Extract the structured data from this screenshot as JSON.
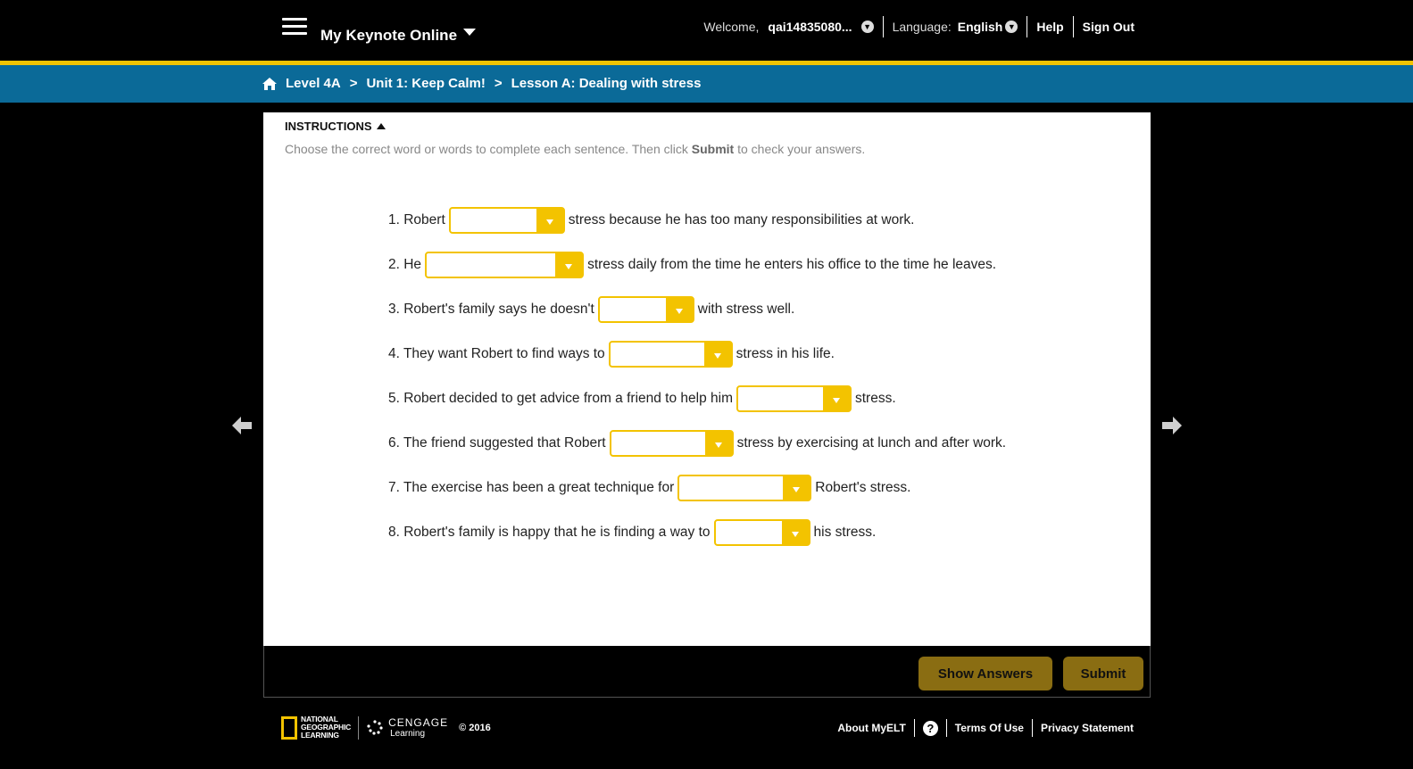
{
  "header": {
    "app_title": "My Keynote Online",
    "welcome_label": "Welcome,",
    "username": "qai14835080...",
    "language_label": "Language:",
    "language_value": "English",
    "help_label": "Help",
    "signout_label": "Sign Out"
  },
  "breadcrumb": {
    "items": [
      "Level 4A",
      "Unit 1: Keep Calm!",
      "Lesson A: Dealing with stress"
    ],
    "separator": ">"
  },
  "instructions": {
    "toggle_label": "INSTRUCTIONS",
    "text_before": "Choose the correct word or words to complete each sentence. Then click ",
    "text_bold": "Submit",
    "text_after": " to check your answers."
  },
  "questions": [
    {
      "before": "1. Robert",
      "after": "stress because he has too many responsibilities at work.",
      "selected": ""
    },
    {
      "before": "2. He",
      "after": "stress daily from the time he enters his office to the time he leaves.",
      "selected": ""
    },
    {
      "before": "3. Robert's family says he doesn't",
      "after": "with stress well.",
      "selected": ""
    },
    {
      "before": "4. They want Robert to find ways to",
      "after": "stress in his life.",
      "selected": ""
    },
    {
      "before": "5. Robert decided to get advice from a friend to help him",
      "after": "stress.",
      "selected": ""
    },
    {
      "before": "6. The friend suggested that Robert",
      "after": "stress by exercising at lunch and after work.",
      "selected": ""
    },
    {
      "before": "7. The exercise has been a great technique for",
      "after": "Robert's stress.",
      "selected": ""
    },
    {
      "before": "8. Robert's family is happy that he is finding a way to",
      "after": "his stress.",
      "selected": ""
    }
  ],
  "actions": {
    "show_answers": "Show Answers",
    "submit": "Submit"
  },
  "footer": {
    "ng_line1": "NATIONAL",
    "ng_line2": "GEOGRAPHIC",
    "ng_line3": "LEARNING",
    "cengage_line1": "CENGAGE",
    "cengage_line2": "Learning",
    "copyright": "© 2016",
    "about": "About MyELT",
    "terms": "Terms Of Use",
    "privacy": "Privacy Statement"
  },
  "colors": {
    "accent_gold": "#f3c300",
    "breadcrumb_blue": "#0b6a98",
    "button_gold": "#8a6d12"
  }
}
